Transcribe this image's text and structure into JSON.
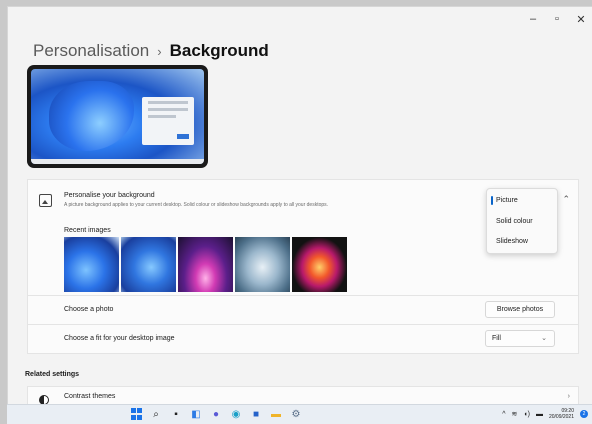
{
  "window": {
    "caption": {
      "minimize": "–",
      "maximize": "▫",
      "close": "✕"
    }
  },
  "breadcrumb": {
    "parent": "Personalisation",
    "separator": "›",
    "current": "Background"
  },
  "background_section": {
    "title": "Personalise your background",
    "description": "A picture background applies to your current desktop. Solid colour or slideshow backgrounds apply to all your desktops.",
    "selected": "Picture",
    "options": [
      "Picture",
      "Solid colour",
      "Slideshow"
    ]
  },
  "recent_images": {
    "label": "Recent images",
    "items": [
      "bloom-blue",
      "bloom-blue-2",
      "glow-purple",
      "flow-grey",
      "flower-dark"
    ]
  },
  "choose_photo": {
    "label": "Choose a photo",
    "button": "Browse photos"
  },
  "choose_fit": {
    "label": "Choose a fit for your desktop image",
    "value": "Fill"
  },
  "related_settings": {
    "heading": "Related settings",
    "items": [
      {
        "label": "Contrast themes"
      }
    ]
  },
  "taskbar": {
    "icons": [
      "start-icon",
      "search-icon",
      "task-view-icon",
      "widgets-icon",
      "chat-icon",
      "edge-icon",
      "store-icon",
      "file-explorer-icon",
      "settings-icon"
    ],
    "tray": {
      "time": "09:20",
      "date": "20/09/2021",
      "notifications": "2"
    }
  },
  "colors": {
    "accent": "#0a64c8",
    "taskbar_blue": "#1a73e8"
  }
}
